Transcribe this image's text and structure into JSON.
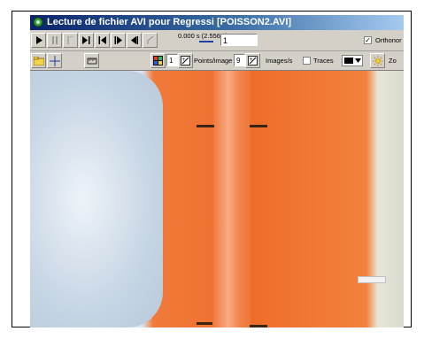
{
  "window": {
    "title": "Lecture de fichier AVI pour Regressi [POISSON2.AVI]"
  },
  "toolbar1": {
    "time_display": "0.000 s (2.556 s)",
    "frame_value": "1",
    "orthonormal_label": "Orthonor",
    "orthonormal_checked": "✓"
  },
  "toolbar2": {
    "points_per_image_value": "1",
    "points_per_image_label": "Points/image",
    "images_per_second_value": "9",
    "images_per_second_label": "Images/s",
    "traces_label": "Traces",
    "zoom_label": "Zo"
  },
  "colors": {
    "title_bar": "#0a246a",
    "chrome": "#d4d0c8",
    "video_orange": "#ef6d2b"
  }
}
